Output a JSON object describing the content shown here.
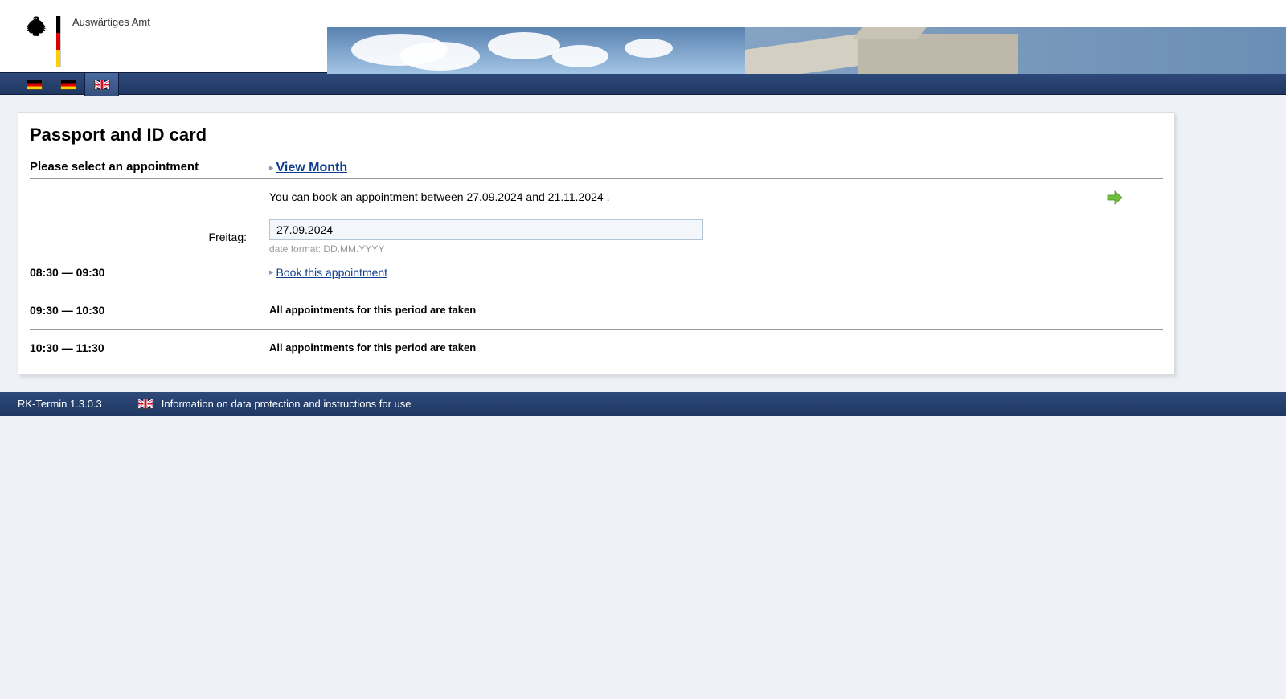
{
  "site_name": "Auswärtiges Amt",
  "languages": [
    "de",
    "de",
    "en"
  ],
  "active_language_index": 2,
  "page_title": "Passport and ID card",
  "subheader": "Please select an appointment",
  "view_month_label": "View Month",
  "booking_range_text": "You can book an appointment between 27.09.2024 and 21.11.2024 .",
  "date_label": "Freitag:",
  "date_value": "27.09.2024",
  "date_hint": "date format: DD.MM.YYYY",
  "book_link_label": "Book this appointment",
  "taken_label": "All appointments for this period are taken",
  "slots": [
    {
      "time": "08:30 — 09:30",
      "available": true
    },
    {
      "time": "09:30 — 10:30",
      "available": false
    },
    {
      "time": "10:30 — 11:30",
      "available": false
    }
  ],
  "footer_version": "RK-Termin 1.3.0.3",
  "footer_info": "Information on data protection and instructions for use"
}
